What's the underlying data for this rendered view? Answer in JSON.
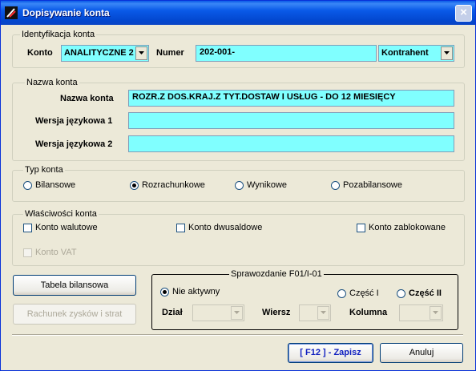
{
  "window": {
    "title": "Dopisywanie konta",
    "close_glyph": "×",
    "accent": "#0a5ae8",
    "field_bg": "#80ffff"
  },
  "identyfikacja": {
    "legend": "Identyfikacja konta",
    "konto_label": "Konto",
    "konto_value": "ANALITYCZNE 2",
    "numer_label": "Numer",
    "numer_value": "202-001-",
    "kontrahent_value": "Kontrahent"
  },
  "nazwa": {
    "legend": "Nazwa konta",
    "nazwa_label": "Nazwa konta",
    "nazwa_value": "ROZR.Z DOS.KRAJ.Z TYT.DOSTAW I USŁUG - DO 12 MIESIĘCY",
    "wersja1_label": "Wersja językowa 1",
    "wersja1_value": "",
    "wersja2_label": "Wersja językowa 2",
    "wersja2_value": ""
  },
  "typ": {
    "legend": "Typ konta",
    "options": [
      "Bilansowe",
      "Rozrachunkowe",
      "Wynikowe",
      "Pozabilansowe"
    ],
    "selected": "Rozrachunkowe"
  },
  "wlasciwosci": {
    "legend": "Właściwości konta",
    "walutowe": "Konto walutowe",
    "dwusaldowe": "Konto dwusaldowe",
    "zablokowane": "Konto zablokowane",
    "vat": "Konto VAT"
  },
  "buttons": {
    "tabela": "Tabela bilansowa",
    "rachunek": "Rachunek zysków i strat",
    "zapisz": "[ F12 ] - Zapisz",
    "anuluj": "Anuluj"
  },
  "sprawozdanie": {
    "legend": "Sprawozdanie F01/I-01",
    "nie_aktywny": "Nie aktywny",
    "czesc1": "Część I",
    "czesc2": "Część II",
    "dzial_label": "Dział",
    "wiersz_label": "Wiersz",
    "kolumna_label": "Kolumna",
    "dzial_value": "",
    "wiersz_value": "",
    "kolumna_value": ""
  },
  "icons": {
    "app": "app-logo-icon",
    "close": "close-icon",
    "dropdown": "chevron-down-icon"
  }
}
